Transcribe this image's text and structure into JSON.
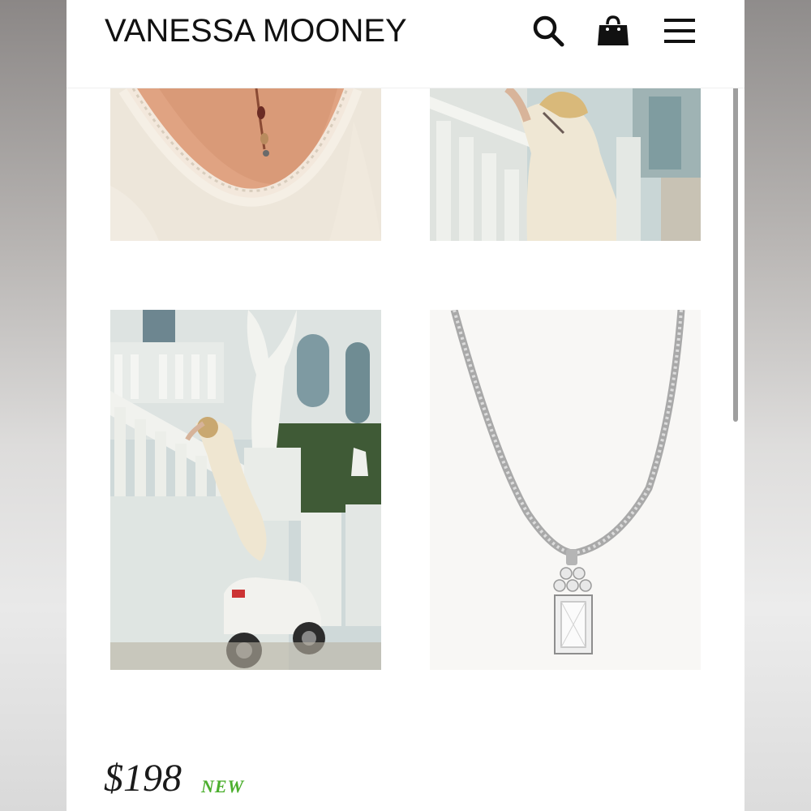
{
  "header": {
    "brand": "VANESSA MOONEY",
    "icons": [
      "search-icon",
      "shopping-bag-icon",
      "hamburger-menu-icon"
    ]
  },
  "gallery": {
    "tiles": [
      {
        "name": "lace-back-necklace-photo"
      },
      {
        "name": "balustrade-slip-dress-photo"
      },
      {
        "name": "angel-statue-scooter-photo"
      },
      {
        "name": "silver-pendant-necklace-product-photo"
      }
    ]
  },
  "listing": {
    "price": "$198",
    "badge": "NEW"
  },
  "colors": {
    "badge_green": "#4caf2e",
    "text": "#1a1a1a",
    "background": "#ffffff"
  }
}
